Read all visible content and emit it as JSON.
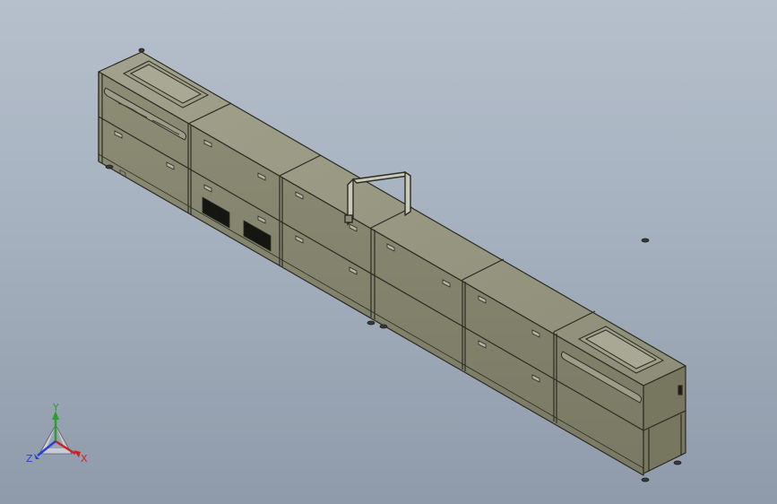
{
  "triad": {
    "y_label": "Y",
    "x_label": "X",
    "z_label": "Z",
    "y_color": "#2e9e2e",
    "x_color": "#cc2222",
    "z_color": "#2a3fcf"
  },
  "model": {
    "body_color": "#85856f",
    "top_color": "#9a9a84",
    "side_color": "#77775f",
    "edge_color": "#2b2b24"
  }
}
